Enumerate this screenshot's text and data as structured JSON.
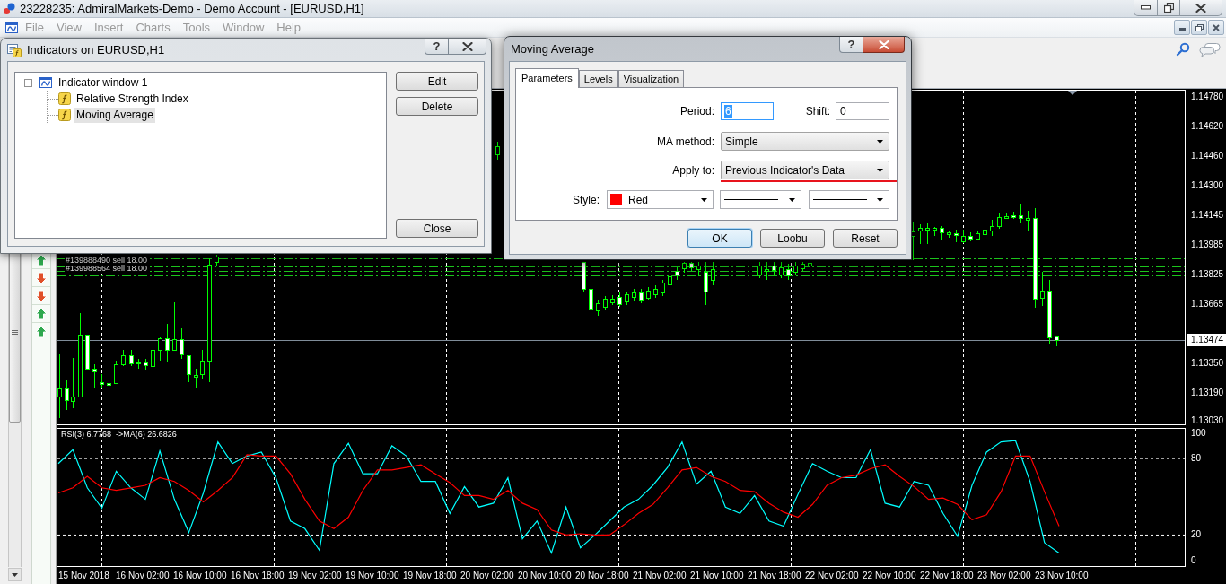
{
  "window": {
    "title": "23228235: AdmiralMarkets-Demo - Demo Account - [EURUSD,H1]"
  },
  "menu": [
    {
      "label": "File",
      "disabled": true
    },
    {
      "label": "View",
      "disabled": true
    },
    {
      "label": "Insert",
      "disabled": true
    },
    {
      "label": "Charts",
      "disabled": true
    },
    {
      "label": "Tools",
      "disabled": true
    },
    {
      "label": "Window",
      "disabled": true
    },
    {
      "label": "Help",
      "disabled": true
    }
  ],
  "trade_markers": [
    {
      "kind": "buy"
    },
    {
      "kind": "sell"
    },
    {
      "kind": "sell"
    },
    {
      "kind": "buy"
    },
    {
      "kind": "buy"
    }
  ],
  "chart": {
    "order_labels": [
      "#139888490 sell 18.00",
      "#139988564 sell 18.00"
    ],
    "price_axis": [
      "1.14780",
      "1.14620",
      "1.14460",
      "1.14300",
      "1.14145",
      "1.13985",
      "1.13825",
      "1.13665",
      "1.13350",
      "1.13190",
      "1.13030"
    ],
    "current_price": "1.13474"
  },
  "rsi": {
    "readings": [
      "6.7768",
      "26.6826"
    ],
    "separator": "->",
    "chart_data": {
      "type": "line",
      "grid": true,
      "ylim": [
        -5,
        104
      ],
      "yticks": [
        0,
        20,
        80,
        100
      ],
      "series": [
        {
          "name": "RSI(3)",
          "color": "#00ffff",
          "values": [
            76,
            87,
            57,
            41,
            70,
            57,
            48,
            86,
            48,
            22,
            53,
            93,
            76,
            82,
            85,
            65,
            31,
            25,
            8,
            76,
            92,
            68,
            68,
            90,
            82,
            62,
            62,
            37,
            58,
            42,
            45,
            65,
            17,
            31,
            6,
            42,
            10,
            20,
            31,
            42,
            48,
            59,
            73,
            93,
            60,
            70,
            42,
            37,
            51,
            31,
            27,
            52,
            76,
            70,
            65,
            65,
            87,
            45,
            42,
            62,
            59,
            37,
            19,
            59,
            85,
            93,
            94,
            62,
            14,
            6
          ]
        },
        {
          "name": "MA(6)",
          "color": "#ff0000",
          "values": [
            53,
            57,
            66,
            57,
            55,
            57,
            59,
            65,
            62,
            55,
            46,
            55,
            65,
            83,
            82,
            82,
            68,
            48,
            31,
            25,
            34,
            55,
            71,
            71,
            73,
            75,
            68,
            61,
            51,
            51,
            48,
            55,
            45,
            40,
            24,
            20,
            21,
            20,
            20,
            28,
            37,
            44,
            57,
            71,
            73,
            66,
            62,
            55,
            54,
            45,
            38,
            34,
            44,
            59,
            65,
            67,
            72,
            75,
            66,
            58,
            48,
            49,
            44,
            32,
            36,
            54,
            82,
            82,
            54,
            27
          ]
        }
      ]
    }
  },
  "time_axis": [
    "15 Nov 2018",
    "16 Nov 02:00",
    "16 Nov 10:00",
    "16 Nov 18:00",
    "19 Nov 02:00",
    "19 Nov 10:00",
    "19 Nov 18:00",
    "20 Nov 02:00",
    "20 Nov 10:00",
    "20 Nov 18:00",
    "21 Nov 02:00",
    "21 Nov 10:00",
    "21 Nov 18:00",
    "22 Nov 02:00",
    "22 Nov 10:00",
    "22 Nov 18:00",
    "23 Nov 02:00",
    "23 Nov 10:00"
  ],
  "indicators_dialog": {
    "title": "Indicators on EURUSD,H1",
    "active": false,
    "help_label": "?",
    "tree": [
      {
        "label": "Indicator window 1",
        "expanded": true,
        "selected": false,
        "children": [
          {
            "label": "Relative Strength Index",
            "selected": false
          },
          {
            "label": "Moving Average",
            "selected": true
          }
        ]
      }
    ],
    "buttons": [
      "Edit",
      "Delete",
      "Close"
    ]
  },
  "ma_dialog": {
    "title": "Moving Average",
    "active": true,
    "help_label": "?",
    "tabs": [
      {
        "label": "Parameters",
        "selected": true
      },
      {
        "label": "Levels",
        "selected": false
      },
      {
        "label": "Visualization",
        "selected": false
      }
    ],
    "period": {
      "label": "Period:",
      "value": "6",
      "focused": true
    },
    "shift": {
      "label": "Shift:",
      "value": "0",
      "focused": false
    },
    "ma_method": {
      "label": "MA method:",
      "value": "Simple"
    },
    "apply_to": {
      "label": "Apply to:",
      "value": "Previous Indicator's Data",
      "underlined": true
    },
    "style": {
      "label": "Style:",
      "color": "#ff0000",
      "color_name": "Red"
    },
    "buttons": [
      {
        "label": "OK",
        "default": true
      },
      {
        "label": "Loobu",
        "default": false
      },
      {
        "label": "Reset",
        "default": false
      }
    ]
  }
}
